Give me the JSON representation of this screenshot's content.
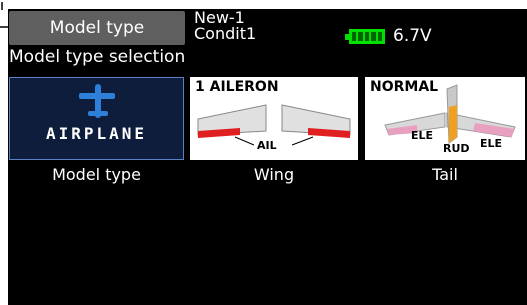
{
  "header": {
    "title": "Model type",
    "model_name": "New-1",
    "condition": "Condit1",
    "battery_voltage": "6.7V"
  },
  "subtitle": "Model type selection",
  "tiles": [
    {
      "label": "Model type",
      "image_text": "AIRPLANE"
    },
    {
      "label": "Wing",
      "image_title": "1 AILERON",
      "image_caption": "AIL"
    },
    {
      "label": "Tail",
      "image_title": "NORMAL",
      "image_left": "ELE",
      "image_center": "RUD",
      "image_right": "ELE"
    }
  ],
  "colors": {
    "screen_bg": "#000000",
    "tab_bg": "#5f5f5f",
    "selected_tile_bg": "#0e1d3c",
    "selected_border": "#5c7fc6",
    "battery": "#00e000",
    "aileron_red": "#e02020",
    "rudder_orange": "#f0a020",
    "elevator_pink": "#e8a0c0",
    "plane_blue": "#2e7fd8"
  },
  "icons": [
    "pointer-arrow-icon",
    "battery-icon",
    "airplane-icon"
  ]
}
